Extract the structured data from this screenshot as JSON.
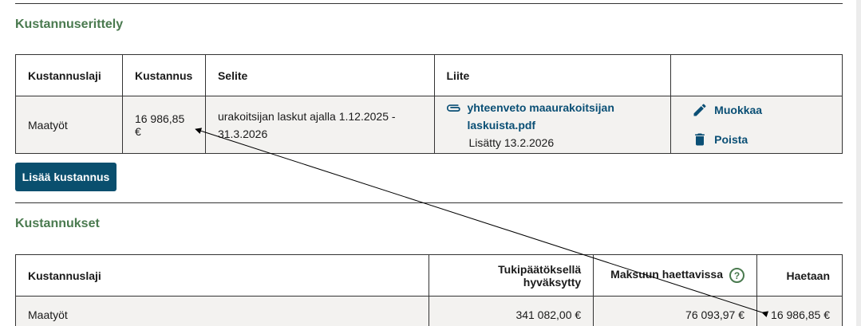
{
  "breakdown": {
    "title": "Kustannuserittely",
    "headers": [
      "Kustannuslaji",
      "Kustannus",
      "Selite",
      "Liite",
      ""
    ],
    "row": {
      "type": "Maatyöt",
      "cost": "16 986,85 €",
      "desc_line1": "urakoitsijan laskut ajalla 1.12.2025 -",
      "desc_line2": "31.3.2026",
      "attachment_line1": "yhteenveto maaurakoitsijan",
      "attachment_line2": "laskuista.pdf",
      "attachment_added": "Lisätty 13.2.2026",
      "edit_label": "Muokkaa",
      "delete_label": "Poista"
    },
    "add_button": "Lisää kustannus"
  },
  "costs": {
    "title": "Kustannukset",
    "headers": [
      "Kustannuslaji",
      "Tukipäätöksellä hyväksytty",
      "Maksuun haettavissa",
      "Haetaan"
    ],
    "help_icon": "?",
    "row": {
      "type": "Maatyöt",
      "approved": "341 082,00 €",
      "available": "76 093,97 €",
      "requested": "16 986,85 €"
    }
  },
  "icons": {
    "attachment": "paperclip-icon",
    "edit": "pencil-icon",
    "delete": "trash-icon",
    "help": "question-circle-icon"
  },
  "colors": {
    "section_title": "#4a7a4f",
    "link": "#0a4f75",
    "button_bg": "#0a4f6e",
    "row_bg": "#f3f2f0"
  }
}
